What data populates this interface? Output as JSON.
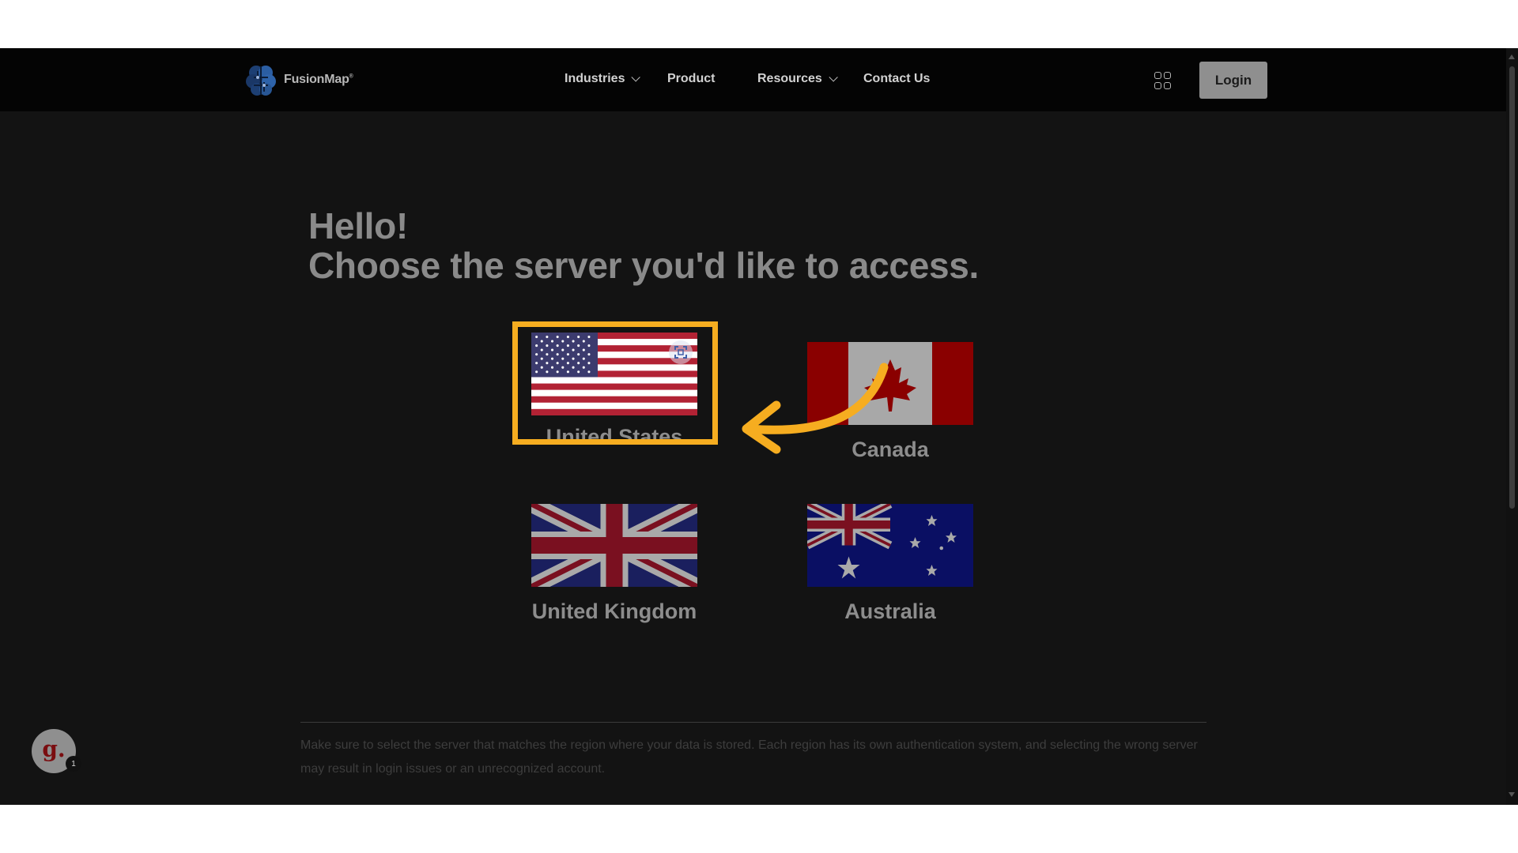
{
  "navbar": {
    "logo_text": "FusionMap",
    "logo_mark": "®",
    "items": [
      {
        "label": "Industries",
        "has_dropdown": true
      },
      {
        "label": "Product",
        "has_dropdown": false
      },
      {
        "label": "Resources",
        "has_dropdown": true
      },
      {
        "label": "Contact Us",
        "has_dropdown": false
      }
    ],
    "apps_icon": "grid-icon",
    "login_label": "Login"
  },
  "main": {
    "greeting": "Hello!",
    "prompt": "Choose the server you'd like to access.",
    "servers": [
      {
        "label": "United States",
        "flag": "us-flag",
        "highlighted": true
      },
      {
        "label": "Canada",
        "flag": "canada-flag",
        "highlighted": false
      },
      {
        "label": "United Kingdom",
        "flag": "uk-flag",
        "highlighted": false
      },
      {
        "label": "Australia",
        "flag": "australia-flag",
        "highlighted": false
      }
    ],
    "note": "Make sure to select the server that matches the region where your data is stored. Each region has its own authentication system, and selecting the wrong server may result in login issues or an unrecognized account."
  },
  "assistant_badge": {
    "letter": "g.",
    "count": "1"
  },
  "colors": {
    "highlight": "#f6ad20",
    "page_background": "#131313",
    "navbar_background": "#040404"
  }
}
